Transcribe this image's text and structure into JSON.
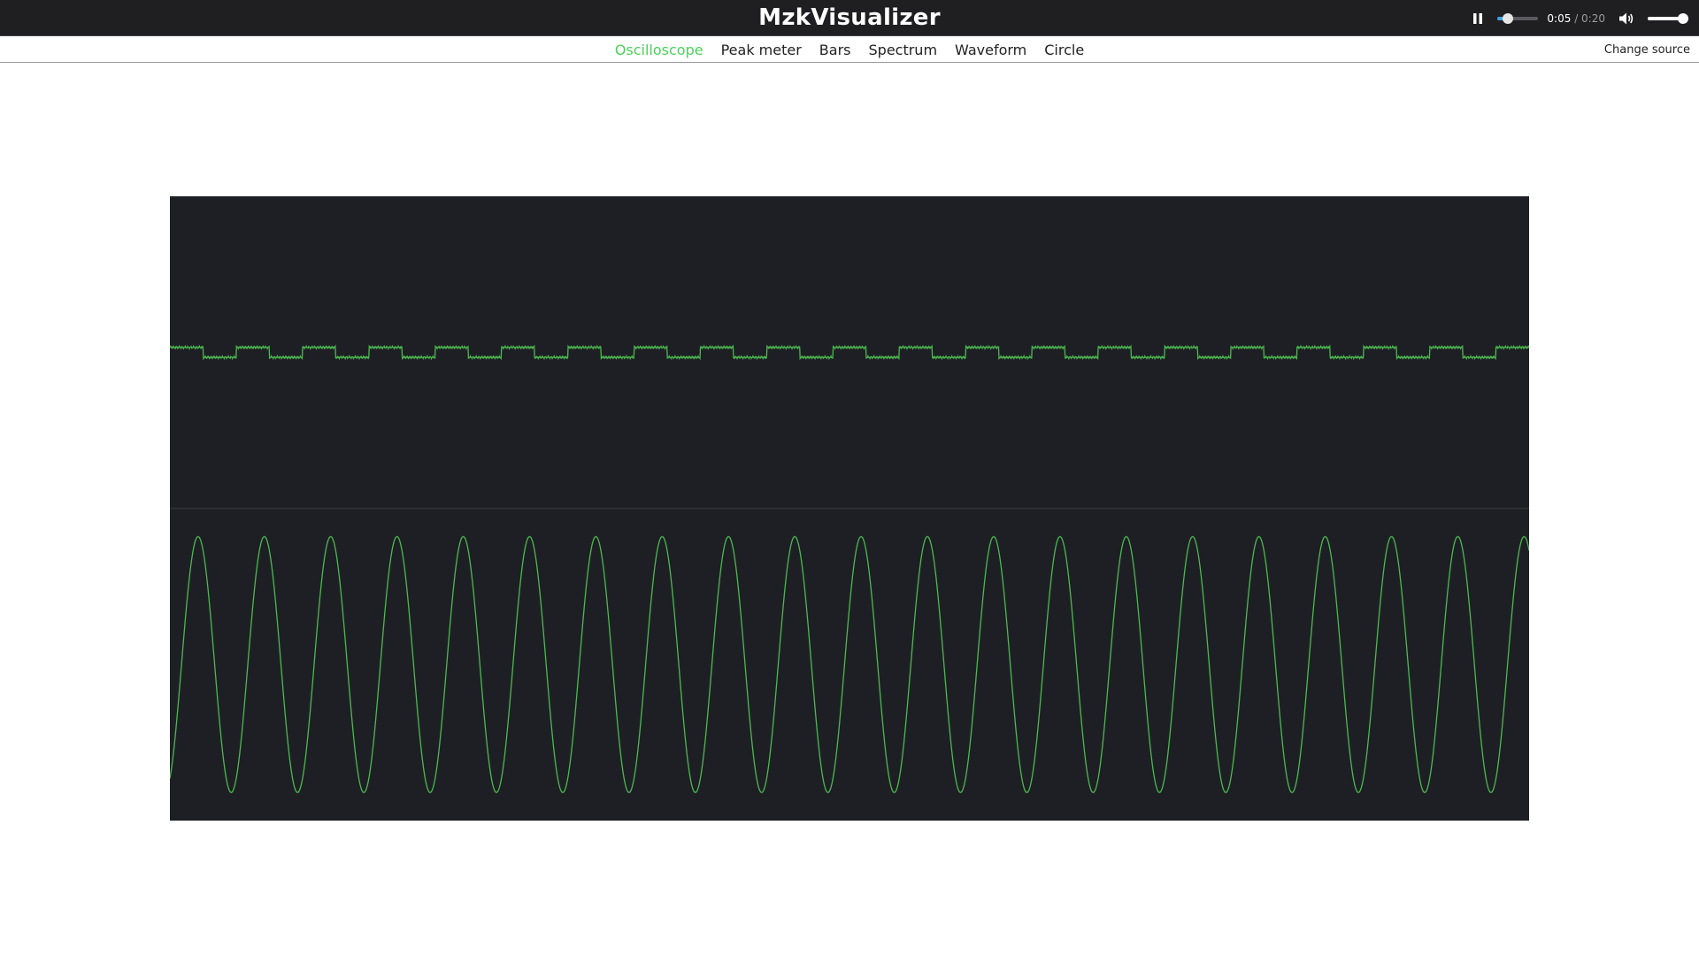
{
  "app": {
    "title": "MzkVisualizer"
  },
  "player": {
    "pause_icon": "pause-icon",
    "current_time": "0:05",
    "separator": " / ",
    "duration": "0:20",
    "progress": 0.25,
    "volume_icon": "volume-icon",
    "volume": 1.0,
    "colors": {
      "progress_fill": "#3da2e0",
      "volume_fill": "#ffffff"
    }
  },
  "nav": {
    "tabs": [
      {
        "label": "Oscilloscope",
        "active": true
      },
      {
        "label": "Peak meter",
        "active": false
      },
      {
        "label": "Bars",
        "active": false
      },
      {
        "label": "Spectrum",
        "active": false
      },
      {
        "label": "Waveform",
        "active": false
      },
      {
        "label": "Circle",
        "active": false
      }
    ],
    "change_source": "Change source",
    "active_color": "#4cd15a"
  },
  "visualizer": {
    "mode": "oscilloscope",
    "background": "#1e1f25",
    "trace_color": "#4cb94f",
    "channels": [
      {
        "name": "top",
        "wave": "square",
        "cycles": 20.5,
        "amplitude": 0.02
      },
      {
        "name": "bottom",
        "wave": "sine",
        "cycles": 20.5,
        "amplitude": 0.82
      }
    ]
  }
}
